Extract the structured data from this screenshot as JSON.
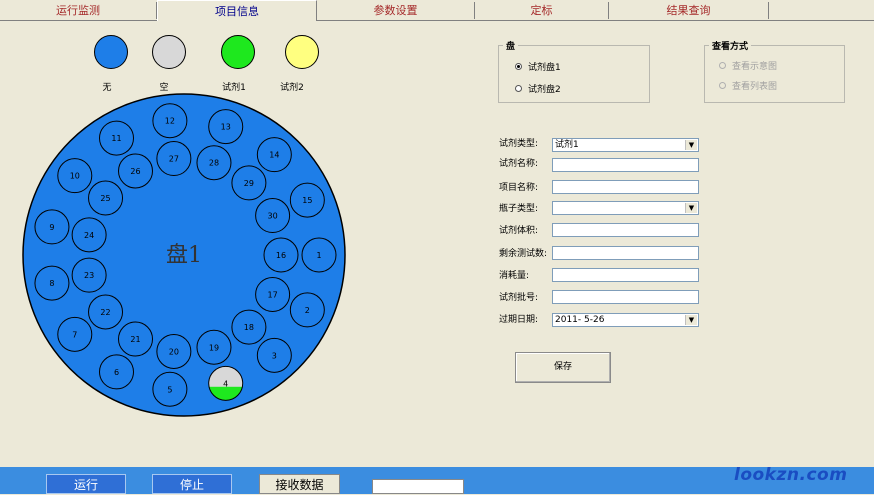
{
  "tabs": [
    {
      "label": "运行监测",
      "active": false
    },
    {
      "label": "项目信息",
      "active": true
    },
    {
      "label": "参数设置",
      "active": false
    },
    {
      "label": "定标",
      "active": false
    },
    {
      "label": "结果查询",
      "active": false
    }
  ],
  "legend": [
    {
      "label": "无",
      "color": "#1e7ee8"
    },
    {
      "label": "空",
      "color": "#d8d8d8"
    },
    {
      "label": "试剂1",
      "color": "#1ee81e"
    },
    {
      "label": "试剂2",
      "color": "#ffff80"
    }
  ],
  "disk": {
    "label": "盘1",
    "color": "#1e7ee8",
    "positions_outer": [
      "1",
      "2",
      "3",
      "4",
      "5",
      "6",
      "7",
      "8",
      "9",
      "10",
      "11",
      "12",
      "13",
      "14",
      "15"
    ],
    "positions_inner": [
      "16",
      "17",
      "18",
      "19",
      "20",
      "21",
      "22",
      "23",
      "24",
      "25",
      "26",
      "27",
      "28",
      "29",
      "30"
    ],
    "partial_position": "4",
    "partial_fill_colors": [
      "#d8d8d8",
      "#1ee81e"
    ],
    "partial_fill_level": 0.4
  },
  "plate_group": {
    "title": "盘",
    "options": [
      {
        "label": "试剂盘1",
        "selected": true
      },
      {
        "label": "试剂盘2",
        "selected": false
      }
    ]
  },
  "view_group": {
    "title": "查看方式",
    "options": [
      {
        "label": "查看示意图",
        "selected": false
      },
      {
        "label": "查看列表图",
        "selected": false
      }
    ]
  },
  "form": {
    "reagent_type_label": "试剂类型:",
    "reagent_type_value": "试剂1",
    "reagent_name_label": "试剂名称:",
    "reagent_name_value": "",
    "item_name_label": "项目名称:",
    "item_name_value": "",
    "bottle_type_label": "瓶子类型:",
    "bottle_type_value": "",
    "reagent_volume_label": "试剂体积:",
    "reagent_volume_value": "",
    "remaining_tests_label": "剩余测试数:",
    "remaining_tests_value": "",
    "consumption_label": "消耗量:",
    "consumption_value": "",
    "batch_label": "试剂批号:",
    "batch_value": "",
    "expiry_label": "过期日期:",
    "expiry_value": "2011- 5-26",
    "save_label": "保存"
  },
  "bottom": {
    "run_label": "运行",
    "stop_label": "停止",
    "receive_label": "接收数据",
    "field_value": ""
  },
  "watermark": "lookzn.com"
}
